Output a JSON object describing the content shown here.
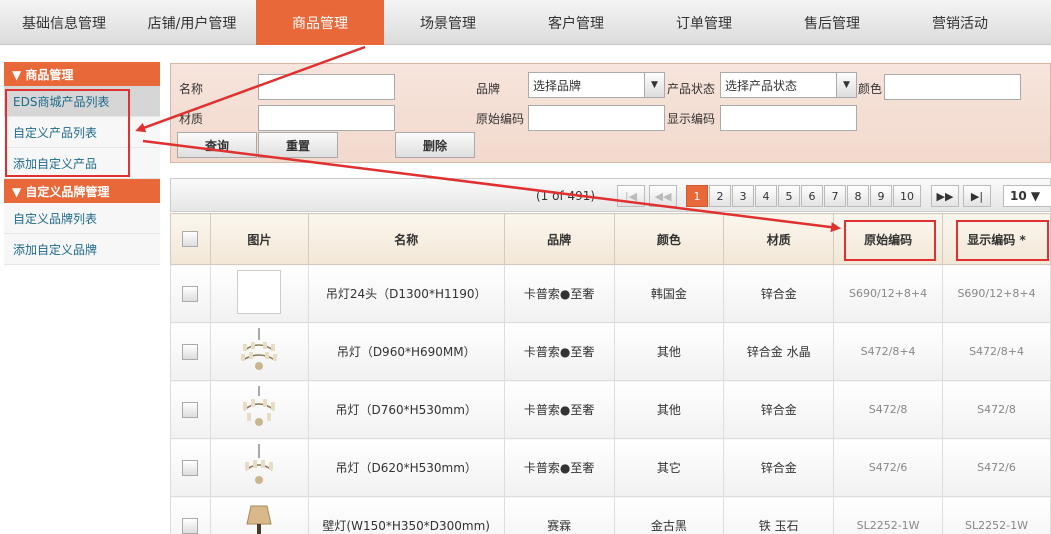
{
  "topnav": {
    "tabs": [
      "基础信息管理",
      "店铺/用户管理",
      "商品管理",
      "场景管理",
      "客户管理",
      "订单管理",
      "售后管理",
      "营销活动"
    ],
    "active_index": 2
  },
  "sidebar": {
    "groups": [
      {
        "title": "▼ 商品管理",
        "items": [
          "EDS商城产品列表",
          "自定义产品列表",
          "添加自定义产品"
        ],
        "active_index": 0
      },
      {
        "title": "▼ 自定义品牌管理",
        "items": [
          "自定义品牌列表",
          "添加自定义品牌"
        ]
      }
    ]
  },
  "search": {
    "name_label": "名称",
    "material_label": "材质",
    "brand_label": "品牌",
    "brand_value": "选择品牌",
    "status_label": "产品状态",
    "status_value": "选择产品状态",
    "color_label": "颜色",
    "orig_code_label": "原始编码",
    "display_code_label": "显示编码",
    "query_button": "查询",
    "reset_button": "重置",
    "delete_button": "删除"
  },
  "pager": {
    "info": "(1 of 491)",
    "first": "|◀",
    "prev": "◀◀",
    "pages": [
      "1",
      "2",
      "3",
      "4",
      "5",
      "6",
      "7",
      "8",
      "9",
      "10"
    ],
    "current": "1",
    "next": "▶▶",
    "last": "▶|",
    "page_size": "10 ▼"
  },
  "table": {
    "headers": [
      "图片",
      "名称",
      "品牌",
      "颜色",
      "材质",
      "原始编码",
      "显示编码 *"
    ],
    "rows": [
      {
        "name": "吊灯24头（D1300*H1190）",
        "brand": "卡普索●至奢",
        "color": "韩国金",
        "material": "锌合金",
        "orig_code": "S690/12+8+4",
        "display_code": "S690/12+8+4",
        "image": "placeholder"
      },
      {
        "name": "吊灯（D960*H690MM）",
        "brand": "卡普索●至奢",
        "color": "其他",
        "material": "锌合金 水晶",
        "orig_code": "S472/8+4",
        "display_code": "S472/8+4",
        "image": "chandelier"
      },
      {
        "name": "吊灯（D760*H530mm）",
        "brand": "卡普索●至奢",
        "color": "其他",
        "material": "锌合金",
        "orig_code": "S472/8",
        "display_code": "S472/8",
        "image": "chandelier"
      },
      {
        "name": "吊灯（D620*H530mm）",
        "brand": "卡普索●至奢",
        "color": "其它",
        "material": "锌合金",
        "orig_code": "S472/6",
        "display_code": "S472/6",
        "image": "chandelier-small"
      },
      {
        "name": "壁灯(W150*H350*D300mm)",
        "brand": "赛霖",
        "color": "金古黑",
        "material": "铁 玉石",
        "orig_code": "SL2252-1W",
        "display_code": "SL2252-1W",
        "image": "wall-lamp"
      }
    ]
  },
  "colors": {
    "accent": "#e8683a",
    "annotation": "#e03030"
  }
}
